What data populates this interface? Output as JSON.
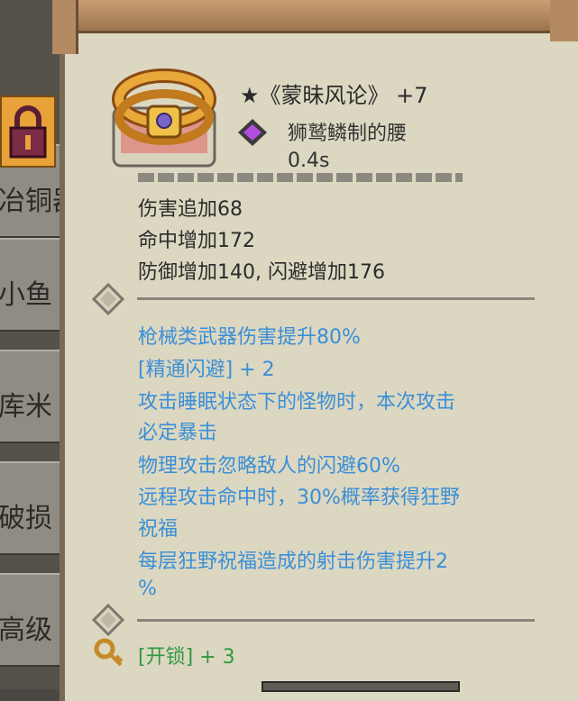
{
  "background_list": {
    "rows": [
      "冶铜器",
      "小鱼",
      "库米",
      "破损",
      "高级"
    ]
  },
  "item": {
    "icon_name": "golden-belt-icon",
    "name": "★《蒙昧风论》 +7",
    "material_icon": "purple-gem-icon",
    "subtitle": "狮鹫鳞制的腰",
    "time": "0.4s"
  },
  "stats": [
    "伤害追加68",
    "命中增加172",
    "防御增加140, 闪避增加176"
  ],
  "effects": [
    "枪械类武器伤害提升80%",
    "[精通闪避] + 2",
    "攻击睡眠状态下的怪物时，本次攻击",
    "必定暴击",
    "物理攻击忽略敌人的闪避60%",
    "远程攻击命中时，30%概率获得狂野",
    "祝福",
    "每层狂野祝福造成的射击伤害提升2",
    "%"
  ],
  "unlock": {
    "icon_name": "key-icon",
    "text": "[开锁] + 3"
  },
  "colors": {
    "effect_blue": "#3b8fd6",
    "unlock_green": "#2f9a42",
    "panel_bg": "#dcd7c1"
  }
}
